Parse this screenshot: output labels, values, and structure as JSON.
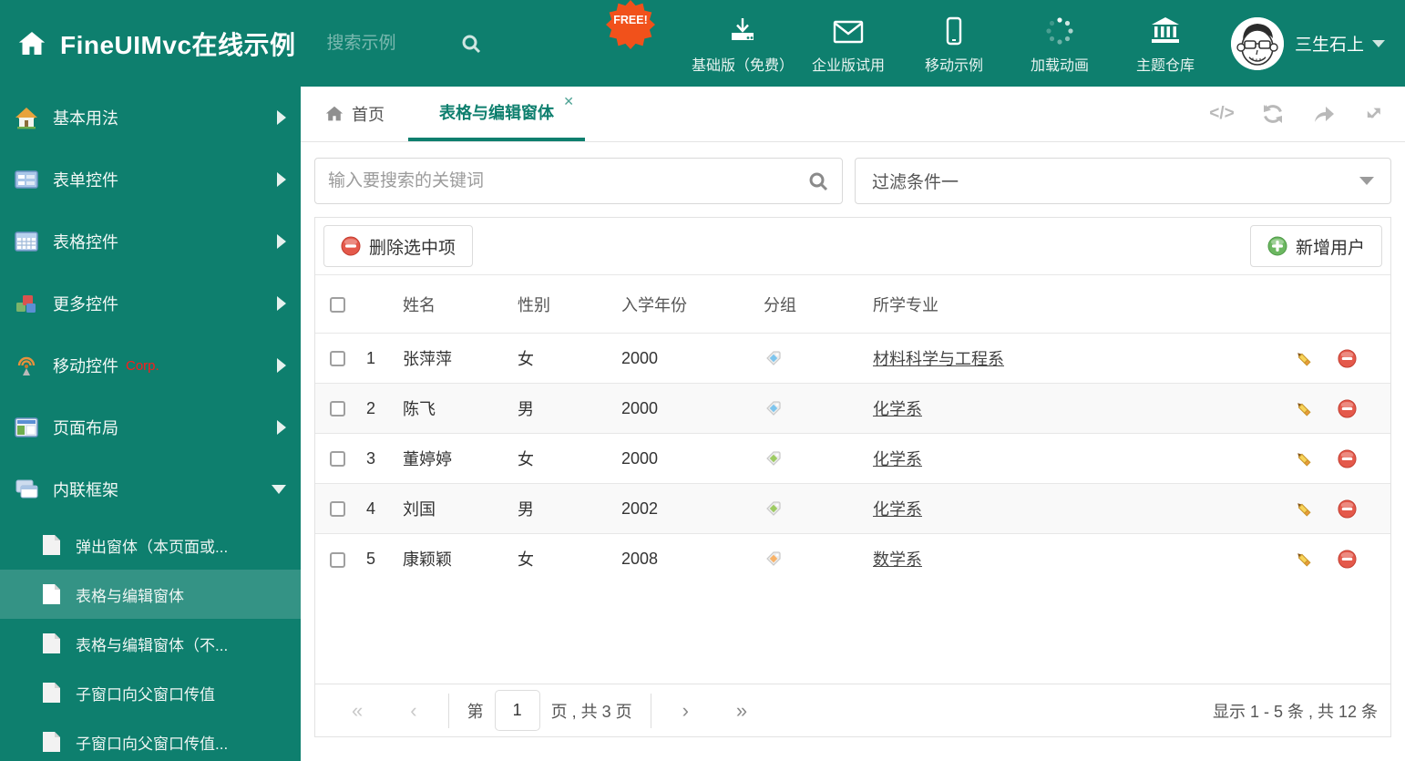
{
  "app": {
    "title": "FineUIMvc在线示例",
    "header_search_placeholder": "搜索示例",
    "free_badge": "FREE!",
    "user_name": "三生石上"
  },
  "header_nav": {
    "basic": "基础版（免费）",
    "enterprise": "企业版试用",
    "mobile": "移动示例",
    "loading": "加载动画",
    "theme": "主题仓库"
  },
  "sidebar": {
    "items": [
      {
        "label": "基本用法"
      },
      {
        "label": "表单控件"
      },
      {
        "label": "表格控件"
      },
      {
        "label": "更多控件"
      },
      {
        "label": "移动控件",
        "badge": "Corp."
      },
      {
        "label": "页面布局"
      },
      {
        "label": "内联框架"
      }
    ],
    "subitems": [
      {
        "label": "弹出窗体（本页面或..."
      },
      {
        "label": "表格与编辑窗体"
      },
      {
        "label": "表格与编辑窗体（不..."
      },
      {
        "label": "子窗口向父窗口传值"
      },
      {
        "label": "子窗口向父窗口传值..."
      }
    ]
  },
  "tabs": {
    "home": "首页",
    "active": "表格与编辑窗体",
    "close": "✕"
  },
  "filters": {
    "search_placeholder": "输入要搜索的关键词",
    "filter_value": "过滤条件一"
  },
  "toolbar": {
    "delete_label": "删除选中项",
    "add_label": "新增用户"
  },
  "table": {
    "columns": {
      "name": "姓名",
      "gender": "性别",
      "year": "入学年份",
      "group": "分组",
      "major": "所学专业"
    },
    "rows": [
      {
        "num": "1",
        "name": "张萍萍",
        "gender": "女",
        "year": "2000",
        "tag": "#7DC5EE",
        "major": "材料科学与工程系"
      },
      {
        "num": "2",
        "name": "陈飞",
        "gender": "男",
        "year": "2000",
        "tag": "#7DC5EE",
        "major": "化学系"
      },
      {
        "num": "3",
        "name": "董婷婷",
        "gender": "女",
        "year": "2000",
        "tag": "#9DCB62",
        "major": "化学系"
      },
      {
        "num": "4",
        "name": "刘国",
        "gender": "男",
        "year": "2002",
        "tag": "#9DCB62",
        "major": "化学系"
      },
      {
        "num": "5",
        "name": "康颖颖",
        "gender": "女",
        "year": "2008",
        "tag": "#F8B267",
        "major": "数学系"
      }
    ]
  },
  "pagination": {
    "first": "«",
    "prev": "‹",
    "next": "›",
    "last": "»",
    "prefix": "第",
    "page": "1",
    "suffix": "页 , 共 3 页",
    "summary": "显示 1 - 5 条 , 共 12 条"
  },
  "colors": {
    "accent_teal": "#0E7F6E",
    "free_badge_orange": "#F1511B",
    "delete_red": "#E4594B",
    "add_green": "#6CB761",
    "pencil_yellow": "#F7D358"
  }
}
